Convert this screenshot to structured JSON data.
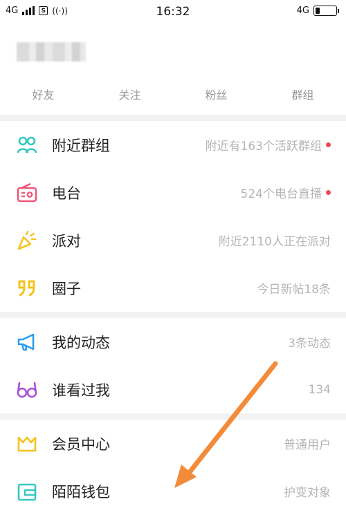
{
  "status_bar": {
    "network_left": "4G",
    "sim_label": "S",
    "time": "16:32",
    "network_right": "4G"
  },
  "stats": [
    {
      "label": "好友"
    },
    {
      "label": "关注"
    },
    {
      "label": "粉丝"
    },
    {
      "label": "群组"
    }
  ],
  "menu": {
    "nearby_groups": {
      "label": "附近群组",
      "detail": "附近有163个活跃群组",
      "icon": "people-icon",
      "badge": true
    },
    "radio": {
      "label": "电台",
      "detail": "524个电台直播",
      "icon": "radio-icon",
      "badge": true
    },
    "party": {
      "label": "派对",
      "detail": "附近2110人正在派对",
      "icon": "party-horn-icon"
    },
    "circle": {
      "label": "圈子",
      "detail": "今日新帖18条",
      "icon": "quote-icon"
    },
    "my_moments": {
      "label": "我的动态",
      "detail": "3条动态",
      "icon": "megaphone-icon"
    },
    "visitors": {
      "label": "谁看过我",
      "detail": "134",
      "icon": "glasses-icon"
    },
    "vip_center": {
      "label": "会员中心",
      "detail": "普通用户",
      "icon": "crown-icon"
    },
    "wallet": {
      "label": "陌陌钱包",
      "detail": "护变对象",
      "icon": "wallet-icon"
    }
  },
  "colors": {
    "badge": "#ef4a55",
    "arrow": "#f28c3a",
    "teal": "#35c8c0",
    "pink": "#f0567a",
    "yellow": "#f6c21c",
    "blue": "#2b9cf0",
    "purple": "#a84fd6"
  }
}
